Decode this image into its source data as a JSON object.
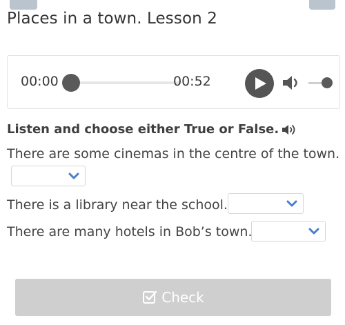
{
  "page": {
    "title": "Places in a town. Lesson 2"
  },
  "player": {
    "current_time": "00:00",
    "total_time": "00:52",
    "progress": 0,
    "volume": 1.0,
    "icons": {
      "play": "play-icon",
      "volume": "volume-icon"
    }
  },
  "task": {
    "instruction": "Listen and choose either True or False.",
    "instruction_icon": "speaker-icon",
    "questions": [
      {
        "text": "There are some cinemas in the centre of the town.",
        "selected": ""
      },
      {
        "text": "There is a library near the school.",
        "selected": ""
      },
      {
        "text": "There are many hotels in Bob’s town.",
        "selected": ""
      }
    ]
  },
  "check_button": {
    "label": "Check",
    "icon": "checkbox-icon"
  },
  "colors": {
    "accent_dark": "#555555",
    "button_disabled": "#cfcfcf",
    "chevron": "#4a7fc9"
  }
}
